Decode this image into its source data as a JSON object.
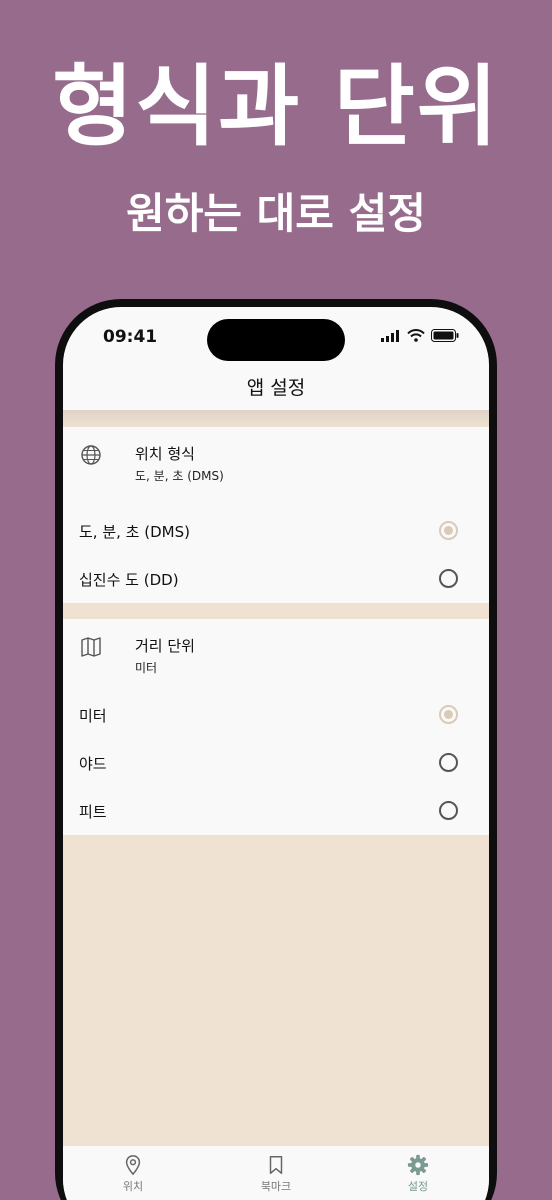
{
  "promo": {
    "title": "형식과 단위",
    "subtitle": "원하는 대로 설정"
  },
  "status_bar": {
    "time": "09:41"
  },
  "nav": {
    "title": "앱 설정"
  },
  "location_format": {
    "title": "위치 형식",
    "current_value": "도, 분, 초 (DMS)",
    "icon": "globe-icon",
    "options": [
      {
        "label": "도, 분, 초 (DMS)",
        "selected": true
      },
      {
        "label": "십진수 도 (DD)",
        "selected": false
      }
    ]
  },
  "distance_unit": {
    "title": "거리 단위",
    "current_value": "미터",
    "icon": "map-icon",
    "options": [
      {
        "label": "미터",
        "selected": true
      },
      {
        "label": "야드",
        "selected": false
      },
      {
        "label": "피트",
        "selected": false
      }
    ]
  },
  "tabbar": {
    "items": [
      {
        "label": "위치",
        "icon": "location-pin-icon",
        "active": false
      },
      {
        "label": "북마크",
        "icon": "bookmark-icon",
        "active": false
      },
      {
        "label": "설정",
        "icon": "gear-icon",
        "active": true
      }
    ]
  },
  "colors": {
    "background": "#966b8c",
    "accent_beige": "#efe2d2",
    "radio_selected": "#d9cbb7",
    "tab_active": "#7a9a93"
  }
}
